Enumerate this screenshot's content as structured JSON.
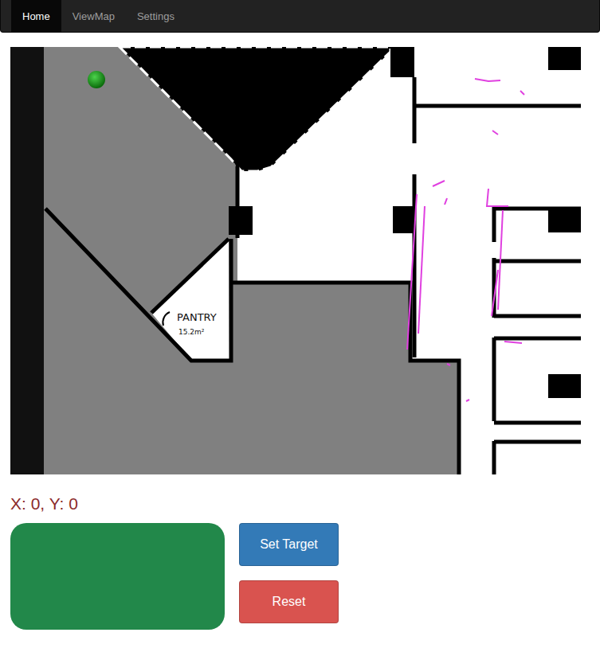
{
  "navbar": {
    "tabs": [
      {
        "label": "Home",
        "selected": true
      },
      {
        "label": "ViewMap",
        "selected": false
      },
      {
        "label": "Settings",
        "selected": false
      }
    ]
  },
  "map": {
    "labels": [
      "PANTRY",
      "15.2m²"
    ]
  },
  "position": {
    "text": "X: 0, Y: 0"
  },
  "buttons": [
    {
      "label": "Set Target",
      "color": "#337ab7"
    },
    {
      "label": "Reset",
      "color": "#d9534f"
    }
  ]
}
